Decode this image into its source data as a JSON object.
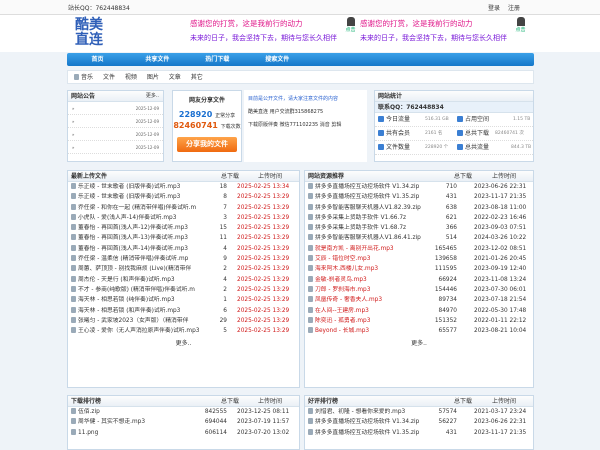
{
  "topbar": {
    "owner_qq": "站长QQ：762448834",
    "login": "登录",
    "register": "注册"
  },
  "logo": {
    "line1": "酷美",
    "line2": "直连"
  },
  "banners": [
    {
      "line1": "感谢您的打赏，这是我前行的动力",
      "line2": "未来的日子，我会坚持下去，期待与您长久相伴",
      "badge": "点击"
    },
    {
      "line1": "感谢您的打赏，这是我前行的动力",
      "line2": "未来的日子，我会坚持下去，期待与您长久相伴",
      "badge": "点击"
    }
  ],
  "nav": [
    "首页",
    "共享文件",
    "热门下载",
    "搜索文件"
  ],
  "subnav": [
    "音乐",
    "文件",
    "视频",
    "图片",
    "文章",
    "其它"
  ],
  "announce": {
    "title": "网站公告",
    "more": "更多..",
    "rows": [
      {
        "arrow": "»",
        "date": "2025-12-09"
      },
      {
        "arrow": "»",
        "date": "2025-12-09"
      },
      {
        "arrow": "»",
        "date": "2025-12-09"
      },
      {
        "arrow": "»",
        "date": "2025-12-09"
      }
    ]
  },
  "share": {
    "title": "网友分享文件",
    "n1": "228920",
    "n1_label": "正常分享",
    "n2": "82460741",
    "n2_label": "下载次数",
    "button": "分享我的文件"
  },
  "notice": [
    "目前是公开文件，请大家注意文件的内容",
    "酷美直连 用户交流群315868275",
    "下载原版伴奏 微信771102235 消音 剪辑"
  ],
  "stats": {
    "title": "网站统计",
    "qq": "联系QQ：762448834",
    "items": [
      {
        "k": "今日流量",
        "v": "516.31 GB",
        "k2": "占用空间",
        "v2": "1.15 TB"
      },
      {
        "k": "共有会员",
        "v": "2161 名",
        "k2": "总共下载",
        "v2": "82460741 次"
      },
      {
        "k": "文件数量",
        "v": "228920 个",
        "k2": "总共流量",
        "v2": "844.3 TB"
      }
    ]
  },
  "latest": {
    "title": "最新上传文件",
    "col_dl": "总下载",
    "col_time": "上传时间",
    "more": "更多..",
    "rows": [
      {
        "name": "乐正绫 - 世末歌者 (旧版伴奏)试听.mp3",
        "dl": "18",
        "time": "2025-02-25 13:34"
      },
      {
        "name": "乐正绫 - 世末歌者 (旧版伴奏)试听.mp3",
        "dl": "8",
        "time": "2025-02-25 13:29"
      },
      {
        "name": "乔任梁 - 和你在一起 (精消带伴唱)伴奏试听.m",
        "dl": "7",
        "time": "2025-02-25 13:29"
      },
      {
        "name": "小虎队 - 爱(浅人声-14)伴奏试听.mp3",
        "dl": "3",
        "time": "2025-02-25 13:29"
      },
      {
        "name": "董春怡 - 再回首(浅人声-12)伴奏试听.mp3",
        "dl": "15",
        "time": "2025-02-25 13:29"
      },
      {
        "name": "董春怡 - 再回首(浅人声-13)伴奏试听.mp3",
        "dl": "11",
        "time": "2025-02-25 13:29"
      },
      {
        "name": "董春怡 - 再回首(浅人声-14)伴奏试听.mp3",
        "dl": "4",
        "time": "2025-02-25 13:29"
      },
      {
        "name": "乔任梁 - 温柔信 (精消带伴唱)伴奏试听.mp",
        "dl": "9",
        "time": "2025-02-25 13:29"
      },
      {
        "name": "周蕙、萨顶顶 - 别找我麻烦 (Live)(精消带伴",
        "dl": "2",
        "time": "2025-02-25 13:29"
      },
      {
        "name": "周杰伦 - 天是行 (和声伴奏)试听.mp3",
        "dl": "4",
        "time": "2025-02-25 13:29"
      },
      {
        "name": "不才 - 参商(纯歌版) (精消带伴唱)伴奏试听.m",
        "dl": "2",
        "time": "2025-02-25 13:29"
      },
      {
        "name": "海天林 - 相思若锁 (纯伴奏)试听.mp3",
        "dl": "1",
        "time": "2025-02-25 13:29"
      },
      {
        "name": "海天林 - 相思若锁 (和声伴奏)试听.mp3",
        "dl": "6",
        "time": "2025-02-25 13:29"
      },
      {
        "name": "张曦匀 - 武家坡2023（女声版）（精消带伴",
        "dl": "29",
        "time": "2025-02-25 13:29"
      },
      {
        "name": "王心凌 - 爱你（无人声消拉原声伴奏)试听.mp3",
        "dl": "5",
        "time": "2025-02-25 13:29"
      }
    ]
  },
  "recommend": {
    "title": "网站资源推荐",
    "col_dl": "总下载",
    "col_time": "上传时间",
    "more": "更多..",
    "rows": [
      {
        "name": "拼多多直播场控互动控场软件 V1.34.zip",
        "dl": "710",
        "time": "2023-06-26 22:31",
        "red": false
      },
      {
        "name": "拼多多直播场控互动控场软件 V1.35.zip",
        "dl": "431",
        "time": "2023-11-17 21:35",
        "red": false
      },
      {
        "name": "拼多多智能客服聊天机器人V1.82.39.zip",
        "dl": "638",
        "time": "2023-08-18 11:00",
        "red": false
      },
      {
        "name": "拼多多采集上货助手软件 V1.66.7z",
        "dl": "621",
        "time": "2022-02-23 16:46",
        "red": false
      },
      {
        "name": "拼多多采集上货助手软件 V1.68.7z",
        "dl": "366",
        "time": "2023-09-03 07:51",
        "red": false
      },
      {
        "name": "拼多多智能客服聊天机器人V1.86.41.zip",
        "dl": "514",
        "time": "2024-03-26 10:22",
        "red": false
      },
      {
        "name": "就是南方凯 - 离别开出花.mp3",
        "dl": "165465",
        "time": "2023-12-02 08:51",
        "red": true
      },
      {
        "name": "艾辰 - 错位时空.mp3",
        "dl": "139658",
        "time": "2021-01-26 20:45",
        "red": true
      },
      {
        "name": "海来阿木.西楼儿女.mp3",
        "dl": "111595",
        "time": "2023-09-19 12:40",
        "red": true
      },
      {
        "name": "金敏-刹者灵鸟.mp3",
        "dl": "66924",
        "time": "2023-11-08 13:24",
        "red": true
      },
      {
        "name": "刀郎 - 罗刹海市.mp3",
        "dl": "154446",
        "time": "2023-07-30 06:01",
        "red": true
      },
      {
        "name": "凤凰传奇 - 奢香夫人.mp3",
        "dl": "89734",
        "time": "2023-07-18 21:54",
        "red": true
      },
      {
        "name": "在人间--王建房.mp3",
        "dl": "84970",
        "time": "2022-05-30 17:48",
        "red": true
      },
      {
        "name": "陈奕迅 - 孤勇者.mp3",
        "dl": "151352",
        "time": "2022-01-11 22:12",
        "red": true
      },
      {
        "name": "Beyond - 长城.mp3",
        "dl": "65577",
        "time": "2023-08-21 10:04",
        "red": true
      }
    ]
  },
  "dlrank": {
    "title": "下载排行榜",
    "col_dl": "总下载",
    "col_time": "上传时间",
    "rows": [
      {
        "name": "伍佰.zip",
        "dl": "842555",
        "time": "2023-12-25 08:11"
      },
      {
        "name": "周华健 - 其实不想走.mp3",
        "dl": "694044",
        "time": "2023-07-19 11:57"
      },
      {
        "name": "11.png",
        "dl": "606114",
        "time": "2023-07-20 13:02"
      }
    ]
  },
  "goodrank": {
    "title": "好评排行榜",
    "col_dl": "总下载",
    "col_time": "上传时间",
    "rows": [
      {
        "name": "刘惜君、初隆 - 想看你来爱的.mp3",
        "dl": "57574",
        "time": "2021-03-17 23:24"
      },
      {
        "name": "拼多多直播场控互动控场软件 V1.34.zip",
        "dl": "56227",
        "time": "2023-06-26 22:31"
      },
      {
        "name": "拼多多直播场控互动控场软件 V1.35.zip",
        "dl": "431",
        "time": "2023-11-17 21:35"
      }
    ]
  }
}
